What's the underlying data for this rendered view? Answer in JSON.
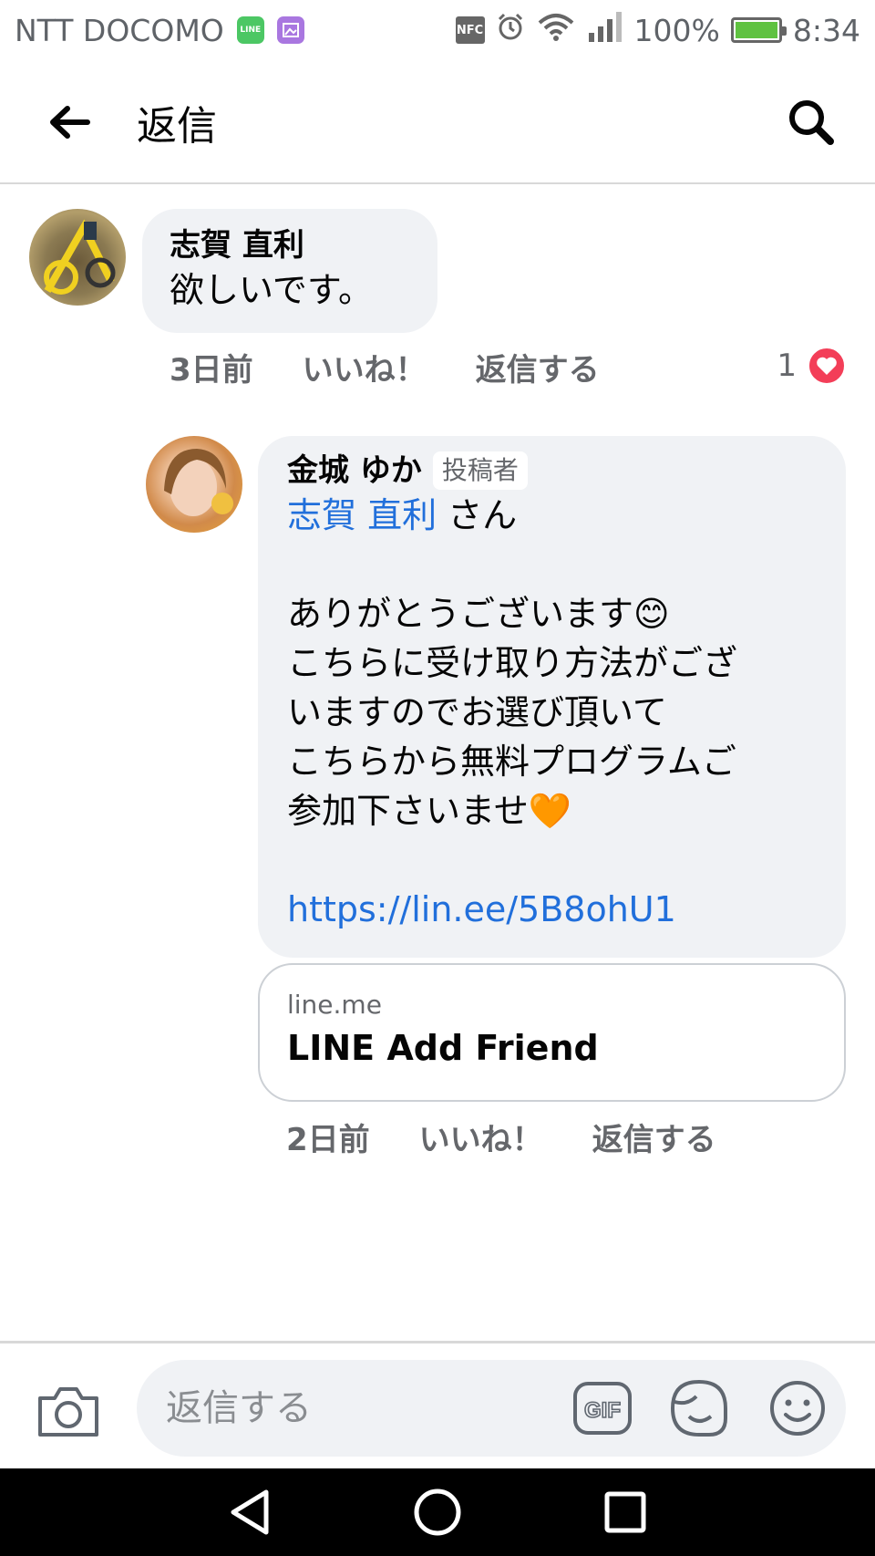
{
  "status_bar": {
    "carrier": "NTT DOCOMO",
    "battery": "100%",
    "time": "8:34"
  },
  "header": {
    "title": "返信"
  },
  "comments": [
    {
      "author": "志賀 直利",
      "text": "欲しいです。",
      "time": "3日前",
      "like_label": "いいね！",
      "reply_label": "返信する",
      "reaction_count": "1"
    },
    {
      "author": "金城 ゆか",
      "badge": "投稿者",
      "mention": "志賀 直利",
      "mention_suffix": " さん",
      "text": "ありがとうございます😊\nこちらに受け取り方法がござ\nいますのでお選び頂いて\nこちらから無料プログラムご\n参加下さいませ🧡",
      "link": "https://lin.ee/5B8ohU1",
      "link_preview": {
        "domain": "line.me",
        "title": "LINE Add Friend"
      },
      "time": "2日前",
      "like_label": "いいね！",
      "reply_label": "返信する"
    }
  ],
  "composer": {
    "placeholder": "返信する",
    "gif_label": "GIF"
  },
  "colors": {
    "accent": "#216fdb",
    "bubble": "#f0f2f5",
    "heart": "#f33e58"
  }
}
